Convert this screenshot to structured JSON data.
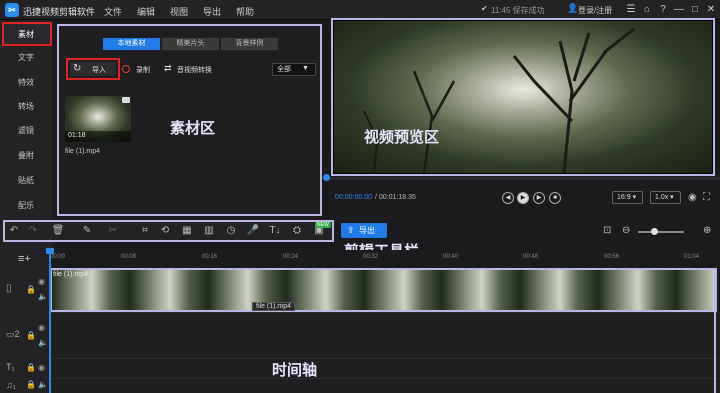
{
  "titlebar": {
    "app_title": "迅捷视频剪辑软件",
    "menu": [
      "文件",
      "编辑",
      "视图",
      "导出",
      "帮助"
    ],
    "save_status": "11:45 保存成功",
    "login": "登录/注册"
  },
  "left_nav": {
    "items": [
      "素材",
      "文字",
      "特效",
      "转场",
      "滤镜",
      "叠附",
      "贴纸",
      "配乐"
    ]
  },
  "media": {
    "tabs": [
      "本地素材",
      "精美片头",
      "背景样例"
    ],
    "import_label": "导入",
    "record_label": "录制",
    "convert_label": "音视频转换",
    "filter_value": "全部",
    "file_duration": "01:18",
    "file_name": "file (1).mp4",
    "area_label": "素材区"
  },
  "preview": {
    "area_label": "视频预览区",
    "current_time": "00:00:00.00",
    "total_time": "/ 00:01:18.35",
    "ratio": "16:9",
    "speed": "1.0x"
  },
  "toolbar": {
    "area_label": "剪辑工具栏",
    "export_label": "导出",
    "new_badge": "NEW"
  },
  "timeline": {
    "area_label": "时间轴",
    "ticks": [
      "00:00",
      "00:08",
      "00:16",
      "00:24",
      "00:32",
      "00:40",
      "00:48",
      "00:56",
      "01:04"
    ],
    "clip_name": "file (1).mp4",
    "clip_tooltip": "file (1).mp4"
  },
  "colors": {
    "accent": "#1f7be8",
    "annotation": "#b9b6e8",
    "highlight": "#e02424"
  }
}
